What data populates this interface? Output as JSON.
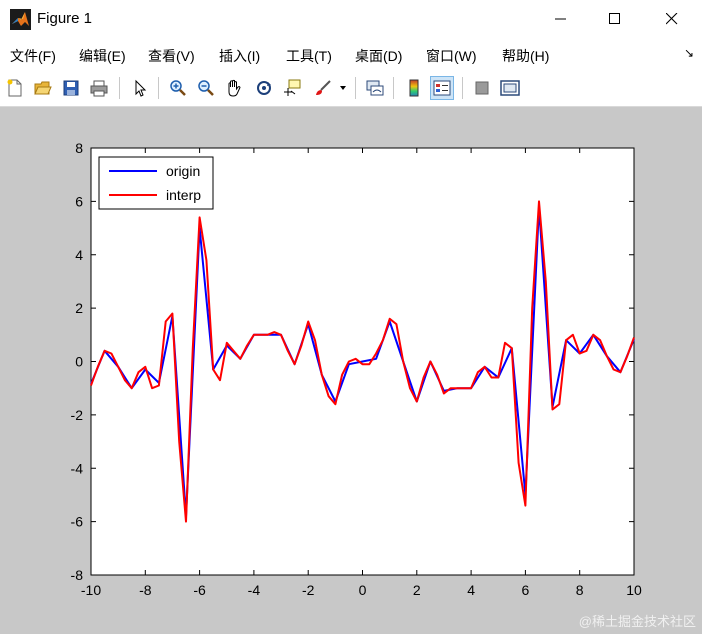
{
  "window": {
    "title": "Figure 1"
  },
  "menubar": {
    "items": [
      {
        "label": "文件(F)"
      },
      {
        "label": "编辑(E)"
      },
      {
        "label": "查看(V)"
      },
      {
        "label": "插入(I)"
      },
      {
        "label": "工具(T)"
      },
      {
        "label": "桌面(D)"
      },
      {
        "label": "窗口(W)"
      },
      {
        "label": "帮助(H)"
      }
    ],
    "dock_arrow": "↘"
  },
  "toolbar": {
    "buttons": [
      "new-figure-icon",
      "open-file-icon",
      "save-icon",
      "print-icon",
      "select-arrow-icon",
      "zoom-in-icon",
      "zoom-out-icon",
      "pan-hand-icon",
      "rotate-3d-icon",
      "data-cursor-icon",
      "brush-icon",
      "brush-dropdown-icon",
      "link-plot-icon",
      "colorbar-icon",
      "legend-icon",
      "hide-plot-tools-icon",
      "show-plot-tools-icon"
    ],
    "pressed": "legend-icon"
  },
  "watermark": "@稀土掘金技术社区",
  "chart_data": {
    "type": "line",
    "title": "",
    "xlabel": "",
    "ylabel": "",
    "xlim": [
      -10,
      10
    ],
    "ylim": [
      -8,
      8
    ],
    "xticks": [
      -10,
      -8,
      -6,
      -4,
      -2,
      0,
      2,
      4,
      6,
      8,
      10
    ],
    "yticks": [
      -8,
      -6,
      -4,
      -2,
      0,
      2,
      4,
      6,
      8
    ],
    "grid": false,
    "legend_position": "top-left",
    "series": [
      {
        "name": "origin",
        "color": "#0000ff",
        "style": "solid",
        "x": [
          -10,
          -9.5,
          -9,
          -8.5,
          -8,
          -7.5,
          -7,
          -6.5,
          -6,
          -5.5,
          -5,
          -4.5,
          -4,
          -3.5,
          -3,
          -2.5,
          -2,
          -1.5,
          -1,
          -0.5,
          0,
          0.5,
          1,
          1.5,
          2,
          2.5,
          3,
          3.5,
          4,
          4.5,
          5,
          5.5,
          6,
          6.5,
          7,
          7.5,
          8,
          8.5,
          9,
          9.5,
          10
        ],
        "y": [
          -0.84,
          0.4,
          -0.2,
          -1.0,
          -0.3,
          -0.8,
          1.7,
          -5.8,
          5.0,
          -0.3,
          0.6,
          0.1,
          1.0,
          1.0,
          1.0,
          -0.1,
          1.4,
          -0.5,
          -1.5,
          -0.1,
          0.0,
          0.1,
          1.5,
          0.0,
          -1.5,
          0.0,
          -1.1,
          -1.0,
          -1.0,
          -0.2,
          -0.6,
          0.5,
          -5.0,
          5.8,
          -1.7,
          0.8,
          0.3,
          1.0,
          0.2,
          -0.4,
          0.84
        ]
      },
      {
        "name": "interp",
        "color": "#ff0000",
        "style": "solid",
        "x": [
          -10,
          -9.75,
          -9.5,
          -9.25,
          -9,
          -8.75,
          -8.5,
          -8.25,
          -8,
          -7.75,
          -7.5,
          -7.25,
          -7,
          -6.75,
          -6.5,
          -6.25,
          -6,
          -5.75,
          -5.5,
          -5.25,
          -5,
          -4.75,
          -4.5,
          -4.25,
          -4,
          -3.75,
          -3.5,
          -3.25,
          -3,
          -2.75,
          -2.5,
          -2.25,
          -2,
          -1.75,
          -1.5,
          -1.25,
          -1,
          -0.75,
          -0.5,
          -0.25,
          0,
          0.25,
          0.5,
          0.75,
          1,
          1.25,
          1.5,
          1.75,
          2,
          2.25,
          2.5,
          2.75,
          3,
          3.25,
          3.5,
          3.75,
          4,
          4.25,
          4.5,
          4.75,
          5,
          5.25,
          5.5,
          5.75,
          6,
          6.25,
          6.5,
          6.75,
          7,
          7.25,
          7.5,
          7.75,
          8,
          8.25,
          8.5,
          8.75,
          9,
          9.25,
          9.5,
          9.75,
          10
        ],
        "y": [
          -0.9,
          -0.2,
          0.4,
          0.3,
          -0.2,
          -0.7,
          -1.0,
          -0.4,
          -0.2,
          -1.0,
          -0.9,
          1.5,
          1.8,
          -3.0,
          -6.0,
          0.5,
          5.4,
          3.8,
          -0.3,
          -0.7,
          0.7,
          0.4,
          0.1,
          0.6,
          1.0,
          1.0,
          1.0,
          1.1,
          1.0,
          0.4,
          -0.1,
          0.6,
          1.5,
          0.8,
          -0.5,
          -1.3,
          -1.6,
          -0.5,
          0.0,
          0.1,
          -0.1,
          -0.1,
          0.3,
          0.8,
          1.6,
          1.4,
          0.0,
          -1.0,
          -1.5,
          -0.6,
          0.0,
          -0.5,
          -1.2,
          -1.0,
          -1.0,
          -1.0,
          -1.0,
          -0.4,
          -0.2,
          -0.6,
          -0.6,
          0.7,
          0.5,
          -3.8,
          -5.4,
          2.0,
          6.0,
          3.0,
          -1.8,
          -1.6,
          0.8,
          1.0,
          0.3,
          0.4,
          1.0,
          0.8,
          0.2,
          -0.3,
          -0.4,
          0.2,
          0.9
        ]
      }
    ]
  }
}
